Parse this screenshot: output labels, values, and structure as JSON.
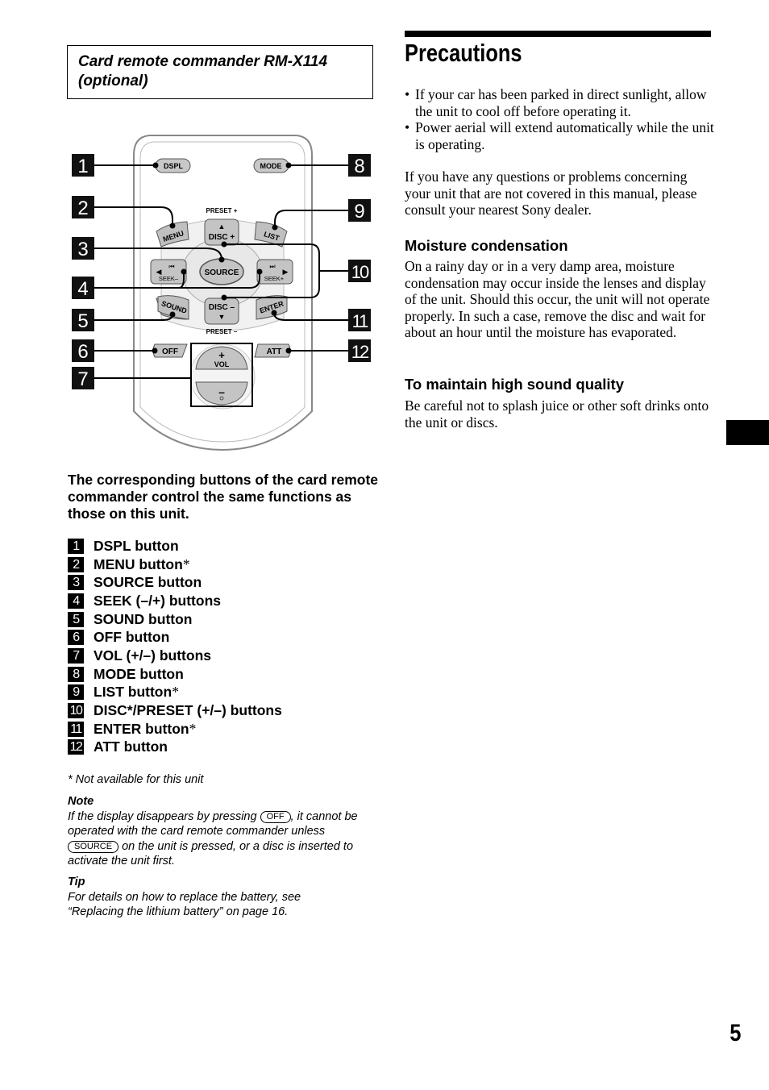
{
  "left": {
    "title_line1": "Card remote commander RM-X114",
    "title_line2": "(optional)",
    "diagram": {
      "buttons": {
        "dspl": "DSPL",
        "mode": "MODE",
        "menu": "MENU",
        "list": "LIST",
        "preset_plus": "PRESET +",
        "preset_minus": "PRESET –",
        "disc_plus": "DISC +",
        "disc_minus": "DISC –",
        "source": "SOURCE",
        "seek_minus": "SEEK–",
        "seek_plus": "SEEK+",
        "sound": "SOUND",
        "enter": "ENTER",
        "off": "OFF",
        "att": "ATT",
        "vol": "VOL",
        "vol_plus": "+",
        "vol_minus": "–"
      },
      "callouts": [
        "1",
        "2",
        "3",
        "4",
        "5",
        "6",
        "7",
        "8",
        "9",
        "10",
        "11",
        "12"
      ]
    },
    "intro": "The corresponding buttons of the card remote commander control the same functions as those on this unit.",
    "button_list": [
      {
        "num": "1",
        "label": "DSPL button",
        "asterisk": ""
      },
      {
        "num": "2",
        "label": "MENU button",
        "asterisk": "*"
      },
      {
        "num": "3",
        "label": "SOURCE button",
        "asterisk": ""
      },
      {
        "num": "4",
        "label": "SEEK (–/+) buttons",
        "asterisk": ""
      },
      {
        "num": "5",
        "label": "SOUND button",
        "asterisk": ""
      },
      {
        "num": "6",
        "label": "OFF button",
        "asterisk": ""
      },
      {
        "num": "7",
        "label": "VOL (+/–) buttons",
        "asterisk": ""
      },
      {
        "num": "8",
        "label": "MODE button",
        "asterisk": ""
      },
      {
        "num": "9",
        "label": "LIST button",
        "asterisk": "*"
      },
      {
        "num": "10",
        "label": "DISC*/PRESET (+/–) buttons",
        "asterisk": ""
      },
      {
        "num": "11",
        "label": "ENTER button",
        "asterisk": "*"
      },
      {
        "num": "12",
        "label": "ATT button",
        "asterisk": ""
      }
    ],
    "footnote": "* Not available for this unit",
    "note": {
      "heading": "Note",
      "text_a": "If the display disappears by pressing ",
      "key_off": "OFF",
      "text_b": ", it cannot be operated with the card remote commander unless ",
      "key_source": "SOURCE",
      "text_c": " on the unit is pressed, or a disc is inserted to activate the unit first."
    },
    "tip": {
      "heading": "Tip",
      "text": "For details on how to replace the battery, see “Replacing the lithium battery” on page 16."
    }
  },
  "right": {
    "heading": "Precautions",
    "bullets": [
      "If your car has been parked in direct sunlight, allow the unit to cool off before operating it.",
      "Power aerial will extend automatically while the unit is operating."
    ],
    "contact_paragraph": "If you have any questions or problems concerning your unit that are not covered in this manual, please consult your nearest Sony dealer.",
    "moisture": {
      "heading": "Moisture condensation",
      "text": "On a rainy day or in a very damp area, moisture condensation may occur inside the lenses and display of the unit. Should this occur, the unit will not operate properly. In such a case, remove the disc and wait for about an hour until the moisture has evaporated."
    },
    "sound_quality": {
      "heading": "To maintain high sound quality",
      "text": "Be careful not to splash juice or other soft drinks onto the unit or discs."
    }
  },
  "page_number": "5"
}
